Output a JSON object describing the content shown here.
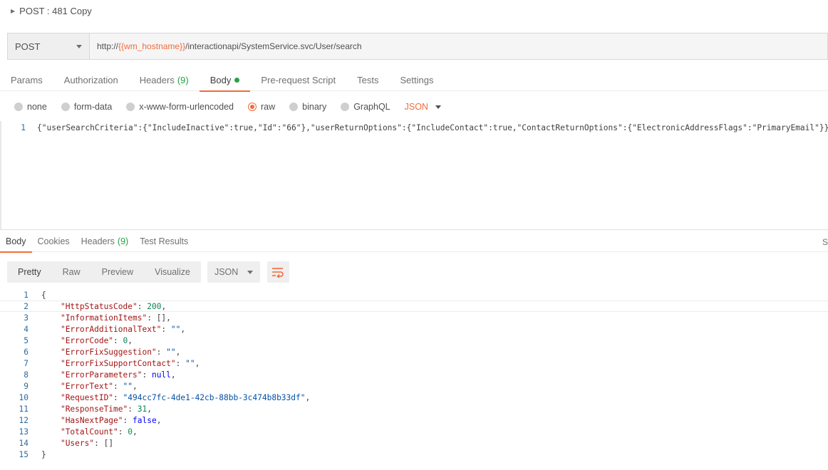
{
  "request": {
    "title": "POST : 481 Copy",
    "method": "POST",
    "url_prefix": "http://",
    "url_variable": "{{wm_hostname}}",
    "url_suffix": "/interactionapi/SystemService.svc/User/search"
  },
  "request_tabs": [
    {
      "label": "Params"
    },
    {
      "label": "Authorization"
    },
    {
      "label": "Headers",
      "count": "(9)"
    },
    {
      "label": "Body",
      "active": true
    },
    {
      "label": "Pre-request Script"
    },
    {
      "label": "Tests"
    },
    {
      "label": "Settings"
    }
  ],
  "body_types": {
    "options": [
      "none",
      "form-data",
      "x-www-form-urlencoded",
      "raw",
      "binary",
      "GraphQL"
    ],
    "selected": "raw",
    "format": "JSON"
  },
  "request_body": {
    "line_number": "1",
    "code": "{\"userSearchCriteria\":{\"IncludeInactive\":true,\"Id\":\"66\"},\"userReturnOptions\":{\"IncludeContact\":true,\"ContactReturnOptions\":{\"ElectronicAddressFlags\":\"PrimaryEmail\"}}}"
  },
  "response_tabs": [
    {
      "label": "Body",
      "active": true
    },
    {
      "label": "Cookies"
    },
    {
      "label": "Headers",
      "count": "(9)"
    },
    {
      "label": "Test Results"
    }
  ],
  "response_toolbar": {
    "views": [
      "Pretty",
      "Raw",
      "Preview",
      "Visualize"
    ],
    "active_view": "Pretty",
    "format": "JSON"
  },
  "response_body": {
    "lines": [
      {
        "num": "1",
        "open": "{"
      },
      {
        "num": "2",
        "key": "\"HttpStatusCode\"",
        "value": "200",
        "vtype": "n",
        "comma": ","
      },
      {
        "num": "3",
        "key": "\"InformationItems\"",
        "value": "[]",
        "vtype": "p",
        "comma": ","
      },
      {
        "num": "4",
        "key": "\"ErrorAdditionalText\"",
        "value": "\"\"",
        "vtype": "s",
        "comma": ","
      },
      {
        "num": "5",
        "key": "\"ErrorCode\"",
        "value": "0",
        "vtype": "n",
        "comma": ","
      },
      {
        "num": "6",
        "key": "\"ErrorFixSuggestion\"",
        "value": "\"\"",
        "vtype": "s",
        "comma": ","
      },
      {
        "num": "7",
        "key": "\"ErrorFixSupportContact\"",
        "value": "\"\"",
        "vtype": "s",
        "comma": ","
      },
      {
        "num": "8",
        "key": "\"ErrorParameters\"",
        "value": "null",
        "vtype": "b",
        "comma": ","
      },
      {
        "num": "9",
        "key": "\"ErrorText\"",
        "value": "\"\"",
        "vtype": "s",
        "comma": ","
      },
      {
        "num": "10",
        "key": "\"RequestID\"",
        "value": "\"494cc7fc-4de1-42cb-88bb-3c474b8b33df\"",
        "vtype": "s",
        "comma": ","
      },
      {
        "num": "11",
        "key": "\"ResponseTime\"",
        "value": "31",
        "vtype": "n",
        "comma": ","
      },
      {
        "num": "12",
        "key": "\"HasNextPage\"",
        "value": "false",
        "vtype": "b",
        "comma": ","
      },
      {
        "num": "13",
        "key": "\"TotalCount\"",
        "value": "0",
        "vtype": "n",
        "comma": ","
      },
      {
        "num": "14",
        "key": "\"Users\"",
        "value": "[]",
        "vtype": "p",
        "comma": ""
      },
      {
        "num": "15",
        "open": "}"
      }
    ]
  },
  "edge_text": "S",
  "colors": {
    "accent": "#f26b3a",
    "count_green": "#26a344",
    "line_number": "#2c6aa0"
  }
}
